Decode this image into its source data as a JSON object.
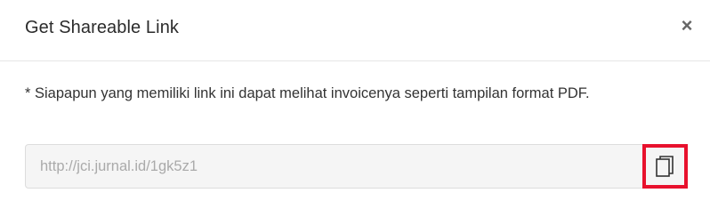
{
  "modal": {
    "title": "Get Shareable Link",
    "close_label": "×",
    "info_text": "* Siapapun yang memiliki link ini dapat melihat invoicenya seperti tampilan format PDF.",
    "link_value": "http://jci.jurnal.id/1gk5z1",
    "copy_icon": "copy-icon",
    "highlight_color": "#e8112d"
  }
}
